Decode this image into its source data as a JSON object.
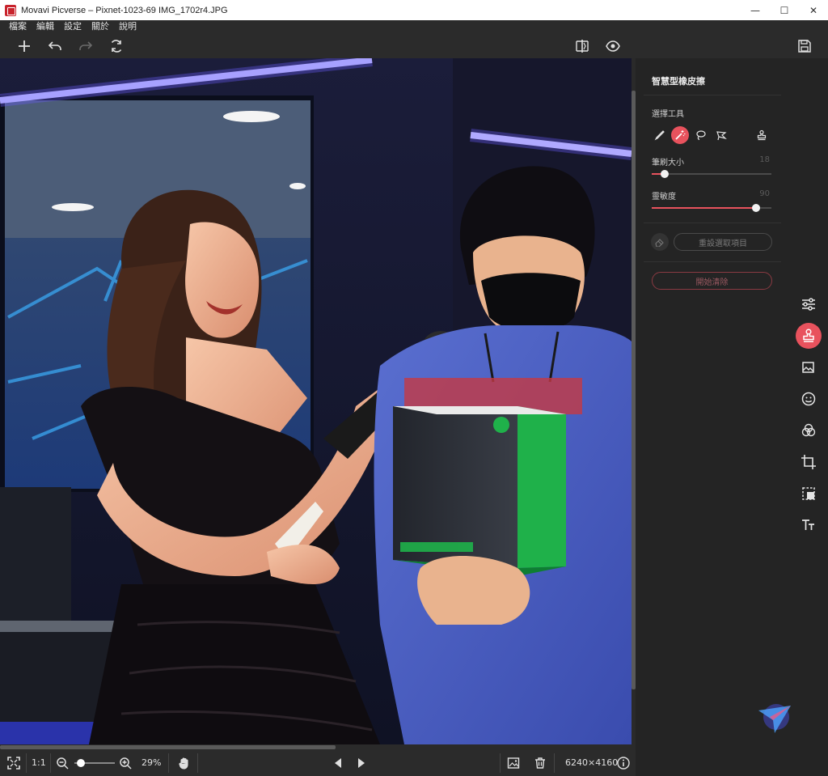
{
  "window": {
    "title": "Movavi Picverse – Pixnet-1023-69 IMG_1702r4.JPG",
    "minimize": "—",
    "maximize": "☐",
    "close": "✕"
  },
  "menu": [
    "檔案",
    "編輯",
    "設定",
    "關於",
    "說明"
  ],
  "toolbar": {
    "icons": [
      "plus-icon",
      "undo-icon",
      "redo-icon",
      "rotate-icon",
      "compare-icon",
      "preview-eye-icon",
      "save-icon"
    ]
  },
  "panel": {
    "title": "智慧型橡皮擦",
    "select_tool_label": "選擇工具",
    "tools": [
      "brush-icon",
      "magic-wand-icon",
      "lasso-icon",
      "polygon-lasso-icon",
      "stamp-icon"
    ],
    "active_tool": "magic-wand-icon",
    "brush_size_label": "筆刷大小",
    "brush_size_value": "18",
    "brush_size_fraction": 0.11,
    "sensitivity_label": "靈敏度",
    "sensitivity_value": "90",
    "sensitivity_fraction": 0.87,
    "reset_selection_label": "重設選取項目",
    "start_erase_label": "開始清除"
  },
  "side_rail": [
    "adjust-sliders-icon",
    "stamp-icon",
    "image-icon",
    "face-icon",
    "color-circles-icon",
    "crop-icon",
    "select-area-icon",
    "text-icon"
  ],
  "active_rail": "stamp-icon",
  "bottombar": {
    "actual_size_label": "1:1",
    "zoom_value": "29%",
    "zoom_fraction": 0.05,
    "image_size": "6240×4160"
  },
  "colors": {
    "accent": "#e8525d",
    "panel_bg": "#242424",
    "bar_bg": "#2b2b2b"
  }
}
